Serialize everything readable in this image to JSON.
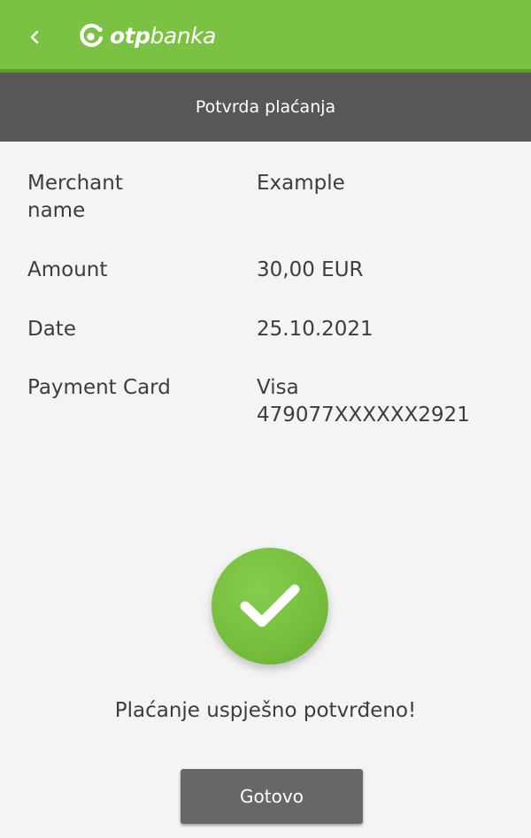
{
  "header": {
    "back_icon": "chevron-left-icon",
    "logo_bold": "otp",
    "logo_light": "banka",
    "background_color": "#7cc242"
  },
  "title_bar": {
    "title": "Potvrda plaćanja",
    "background_color": "#575757"
  },
  "details": [
    {
      "label": "Merchant name",
      "value": "Example"
    },
    {
      "label": "Amount",
      "value": "30,00 EUR"
    },
    {
      "label": "Date",
      "value": "25.10.2021"
    },
    {
      "label": "Payment Card",
      "value_line1": "Visa",
      "value_line2": "479077XXXXXX2921"
    }
  ],
  "status": {
    "icon": "checkmark-circle-icon",
    "message": "Plaćanje uspješno potvrđeno!",
    "color": "#77bf3e"
  },
  "actions": {
    "done_label": "Gotovo"
  }
}
